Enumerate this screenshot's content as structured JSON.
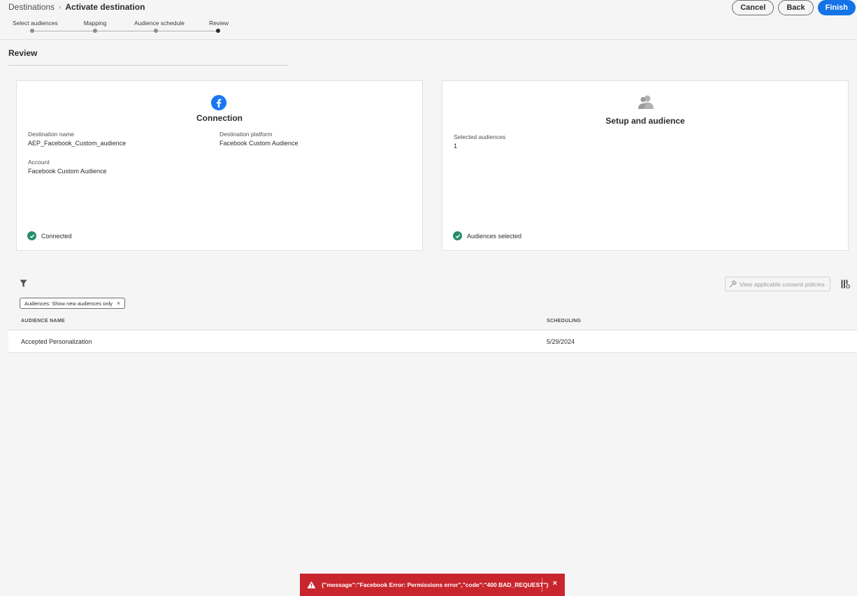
{
  "breadcrumb": {
    "parent": "Destinations",
    "separator": "›",
    "current": "Activate destination"
  },
  "actions": {
    "cancel": "Cancel",
    "back": "Back",
    "finish": "Finish"
  },
  "stepper": {
    "steps": [
      "Select audiences",
      "Mapping",
      "Audience schedule",
      "Review"
    ],
    "active_index": 3
  },
  "page_title": "Review",
  "connection_card": {
    "icon": "facebook-icon",
    "heading": "Connection",
    "destination_name_label": "Destination name",
    "destination_name_value": "AEP_Facebook_Custom_audience",
    "destination_platform_label": "Destination platform",
    "destination_platform_value": "Facebook Custom Audience",
    "account_label": "Account",
    "account_value": "Facebook Custom Audience",
    "status": "Connected"
  },
  "setup_card": {
    "icon": "user-group-icon",
    "heading": "Setup and audience",
    "selected_audiences_label": "Selected audiences",
    "selected_audiences_value": "1",
    "status": "Audiences selected"
  },
  "filters": {
    "chip_label": "Audiences: Show new audiences only",
    "chip_remove": "×"
  },
  "consent_button": "View applicable consent policies",
  "table": {
    "columns": [
      "AUDIENCE NAME",
      "SCHEDULING"
    ],
    "rows": [
      {
        "audience_name": "Accepted Personalization",
        "scheduling": "5/29/2024"
      }
    ]
  },
  "toast": {
    "message": "{\"message\":\"Facebook Error: Permissions error\",\"code\":\"400 BAD_REQUEST\"}",
    "close": "×"
  },
  "colors": {
    "accent": "#1473e6",
    "success": "#268e6c",
    "error": "#c9252d",
    "facebook": "#1877f2"
  }
}
